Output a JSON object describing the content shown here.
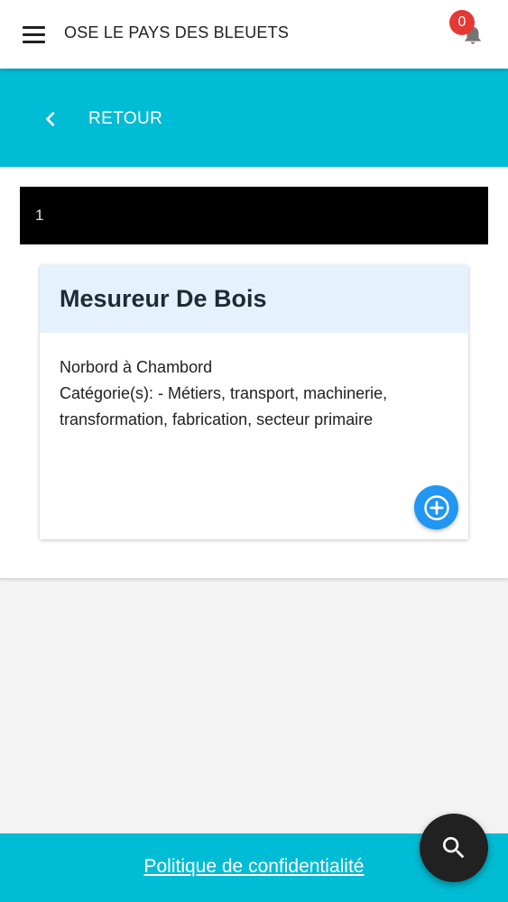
{
  "app": {
    "title": "OSE LE PAYS DES BLEUETS",
    "notification_count": "0"
  },
  "nav": {
    "back_label": "RETOUR"
  },
  "result_bar": {
    "text": "1"
  },
  "job": {
    "title": "Mesureur De Bois",
    "location": "Norbord à Chambord",
    "categories": "Catégorie(s): - Métiers, transport, machinerie, transformation, fabrication, secteur primaire"
  },
  "footer": {
    "privacy_link": "Politique de confidentialité"
  },
  "icons": {
    "menu": "menu-icon",
    "notifications": "bell-icon",
    "back": "chevron-left-icon",
    "add": "add-circle-icon",
    "search": "search-icon"
  },
  "colors": {
    "accent": "#00bcd4",
    "card_header": "#e3f2fd",
    "add_button": "#2196f3",
    "badge": "#e53935",
    "fab": "#212121"
  }
}
